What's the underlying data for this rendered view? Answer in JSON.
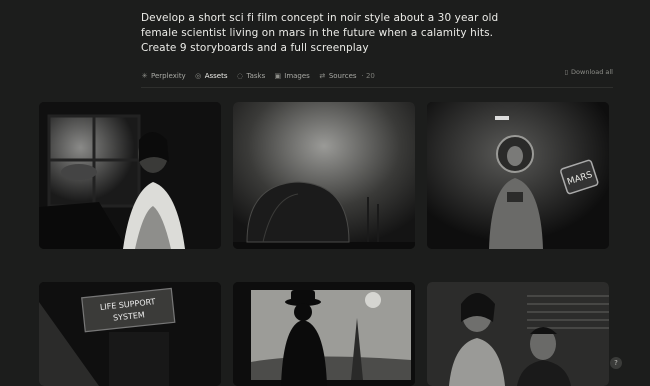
{
  "prompt": {
    "lines": [
      "Develop a short sci fi film concept in noir style about a 30 year old",
      "female scientist living on mars in the future when a calamity hits.",
      "Create 9 storyboards and a full screenplay"
    ]
  },
  "tabs": [
    {
      "label": "Perplexity",
      "icon": "perplexity-icon"
    },
    {
      "label": "Assets",
      "icon": "assets-icon",
      "active": true
    },
    {
      "label": "Tasks",
      "icon": "tasks-icon"
    },
    {
      "label": "Images",
      "icon": "images-icon"
    },
    {
      "label": "Sources",
      "icon": "sources-icon",
      "count": "· 20"
    }
  ],
  "download_label": "Download all",
  "storyboards": [
    {
      "name": "woman-at-window",
      "sign": ""
    },
    {
      "name": "dome-in-storm",
      "sign": ""
    },
    {
      "name": "astronaut-mars-sign",
      "sign": "MARS"
    },
    {
      "name": "life-support-sign",
      "sign": "LIFE SUPPORT SYSTEM"
    },
    {
      "name": "man-in-hat-window",
      "sign": ""
    },
    {
      "name": "woman-and-man-interior",
      "sign": ""
    }
  ],
  "help_label": "?"
}
